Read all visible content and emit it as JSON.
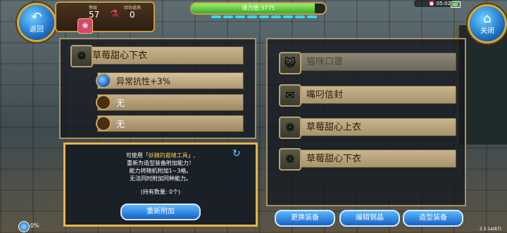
{
  "topbar": {
    "back_label": "返回",
    "close_label": "关闭",
    "level_label": "等级",
    "level_value": "57",
    "recovery_label": "回功道具",
    "recovery_value": "0",
    "stamina_text": "体力值:3775",
    "stamina_fraction": 0.92,
    "clock": "05:02"
  },
  "left_panel": {
    "selected_item": "草莓甜心下衣",
    "options": [
      {
        "label": "异常抗性+3%",
        "selected": true
      },
      {
        "label": "无",
        "selected": false
      },
      {
        "label": "无",
        "selected": false
      }
    ],
    "desc_line1_pre": "可使用「",
    "desc_line1_hl": "妖精的裁缝工具",
    "desc_line1_post": "」,",
    "desc_line2": "重新为造型装备附加能力！",
    "desc_line3": "能力将随机附加1~3格。",
    "desc_line4": "无法同时附加同种能力。",
    "desc_count": "(持有数量: 0个)",
    "reattach_button": "重新附加"
  },
  "right_panel": {
    "items": [
      {
        "label": "猫咪口罩",
        "icon": "cat-mask-icon",
        "active": false
      },
      {
        "label": "嘴叼信封",
        "icon": "envelope-icon",
        "active": true
      },
      {
        "label": "草莓甜心上衣",
        "icon": "top-icon",
        "active": true
      },
      {
        "label": "草莓甜心下衣",
        "icon": "bottom-icon",
        "active": true
      }
    ]
  },
  "bottom": {
    "btn_change": "更换装备",
    "btn_edit": "编辑钢晶",
    "btn_style": "造型装备",
    "progress_text": "0%",
    "version": "3.3.1a(87)"
  }
}
